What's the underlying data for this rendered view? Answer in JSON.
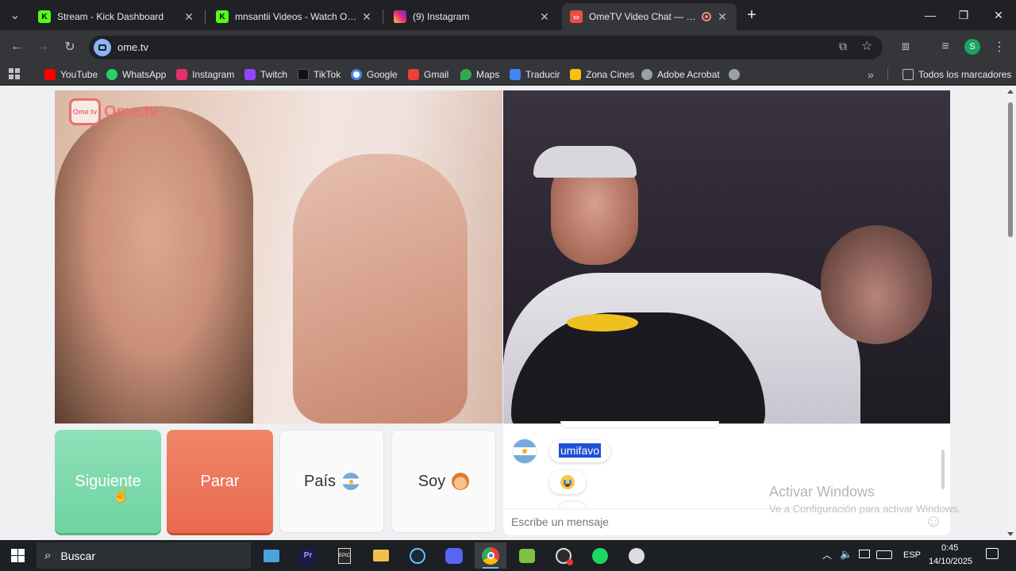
{
  "tabs": [
    {
      "label": "Stream - Kick Dashboard",
      "icon": "kick-icon",
      "close": "✕"
    },
    {
      "label": "mnsantii Videos - Watch On-De",
      "icon": "kick-icon",
      "close": "✕"
    },
    {
      "label": "(9) Instagram",
      "icon": "instagram-icon",
      "close": "✕"
    },
    {
      "label": "OmeTV Video Chat — Ome",
      "icon": "ometv-icon",
      "close": "✕"
    }
  ],
  "new_tab": "+",
  "window_controls": {
    "minimize": "—",
    "restore": "❐",
    "close": "✕"
  },
  "address_bar": {
    "url": "ome.tv"
  },
  "profile_initial": "S",
  "bookmarks": [
    {
      "label": "YouTube",
      "color": "#ff0000"
    },
    {
      "label": "WhatsApp",
      "color": "#25d366"
    },
    {
      "label": "Instagram",
      "color": "#e1306c"
    },
    {
      "label": "Twitch",
      "color": "#9146ff"
    },
    {
      "label": "TikTok",
      "color": "#111111"
    },
    {
      "label": "Google",
      "color": "#4285f4"
    },
    {
      "label": "Gmail",
      "color": "#ea4335"
    },
    {
      "label": "Maps",
      "color": "#34a853"
    },
    {
      "label": "Traducir",
      "color": "#4285f4"
    },
    {
      "label": "Zona Cines",
      "color": "#f4c20d"
    },
    {
      "label": "Adobe Acrobat",
      "color": "#9aa0a6"
    }
  ],
  "bookmarks_more": "»",
  "all_bookmarks": "Todos los marcadores",
  "logo": {
    "badge": "Ome tv",
    "text": "Ome.tv"
  },
  "controls": {
    "next": "Siguiente",
    "stop": "Parar",
    "country": "País",
    "country_flag": "🇦🇷",
    "gender": "Soy",
    "gender_emoji": "👦"
  },
  "chat": {
    "messages": [
      {
        "text": "umifavo",
        "selected": true
      },
      {
        "text": "😭",
        "selected": false
      }
    ],
    "placeholder": "Escribe un mensaje",
    "emoji_button": "☺"
  },
  "watermark": {
    "title": "Activar Windows",
    "subtitle": "Ve a Configuración para activar Windows."
  },
  "taskbar": {
    "search_label": "Buscar",
    "language": "ESP",
    "time": "0:45",
    "date": "14/10/2025"
  },
  "colors": {
    "next_button": "#6ed3a1",
    "stop_button": "#ea6a4f",
    "browser_dark": "#202124",
    "tab_active": "#35363a"
  }
}
